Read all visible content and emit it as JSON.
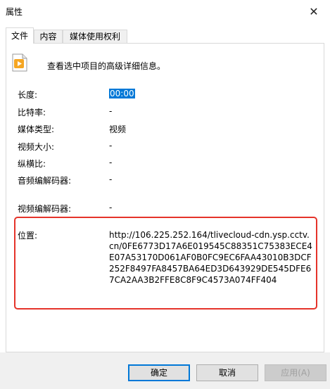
{
  "window": {
    "title": "属性",
    "close_glyph": "✕"
  },
  "tabs": [
    {
      "label": "文件",
      "active": true
    },
    {
      "label": "内容",
      "active": false
    },
    {
      "label": "媒体使用权利",
      "active": false
    }
  ],
  "header": {
    "icon": "video-file-icon",
    "text": "查看选中项目的高级详细信息。"
  },
  "properties": [
    {
      "label": "长度:",
      "value": "00:00"
    },
    {
      "label": "比特率:",
      "value": "-"
    },
    {
      "label": "媒体类型:",
      "value": "视频"
    },
    {
      "label": "视频大小:",
      "value": "-"
    },
    {
      "label": "纵横比:",
      "value": "-"
    },
    {
      "label": "音频编解码器:",
      "value": "-"
    },
    {
      "label": "视频编解码器:",
      "value": "-"
    }
  ],
  "location": {
    "label": "位置:",
    "value": "http://106.225.252.164/tlivecloud-cdn.ysp.cctv.cn/0FE6773D17A6E019545C88351C75383ECE4E07A53170D061AF0B0FC9EC6FAA43010B3DCF252F8497FA8457BA64ED3D643929DE545DFE67CA2AA3B2FFE8C8F9C4573A074FF404"
  },
  "buttons": {
    "ok": "确定",
    "cancel": "取消",
    "apply": "应用(A)"
  },
  "colors": {
    "selection": "#0078d7",
    "highlight_border": "#e5332a",
    "footer_bg": "#f0f0f0"
  }
}
